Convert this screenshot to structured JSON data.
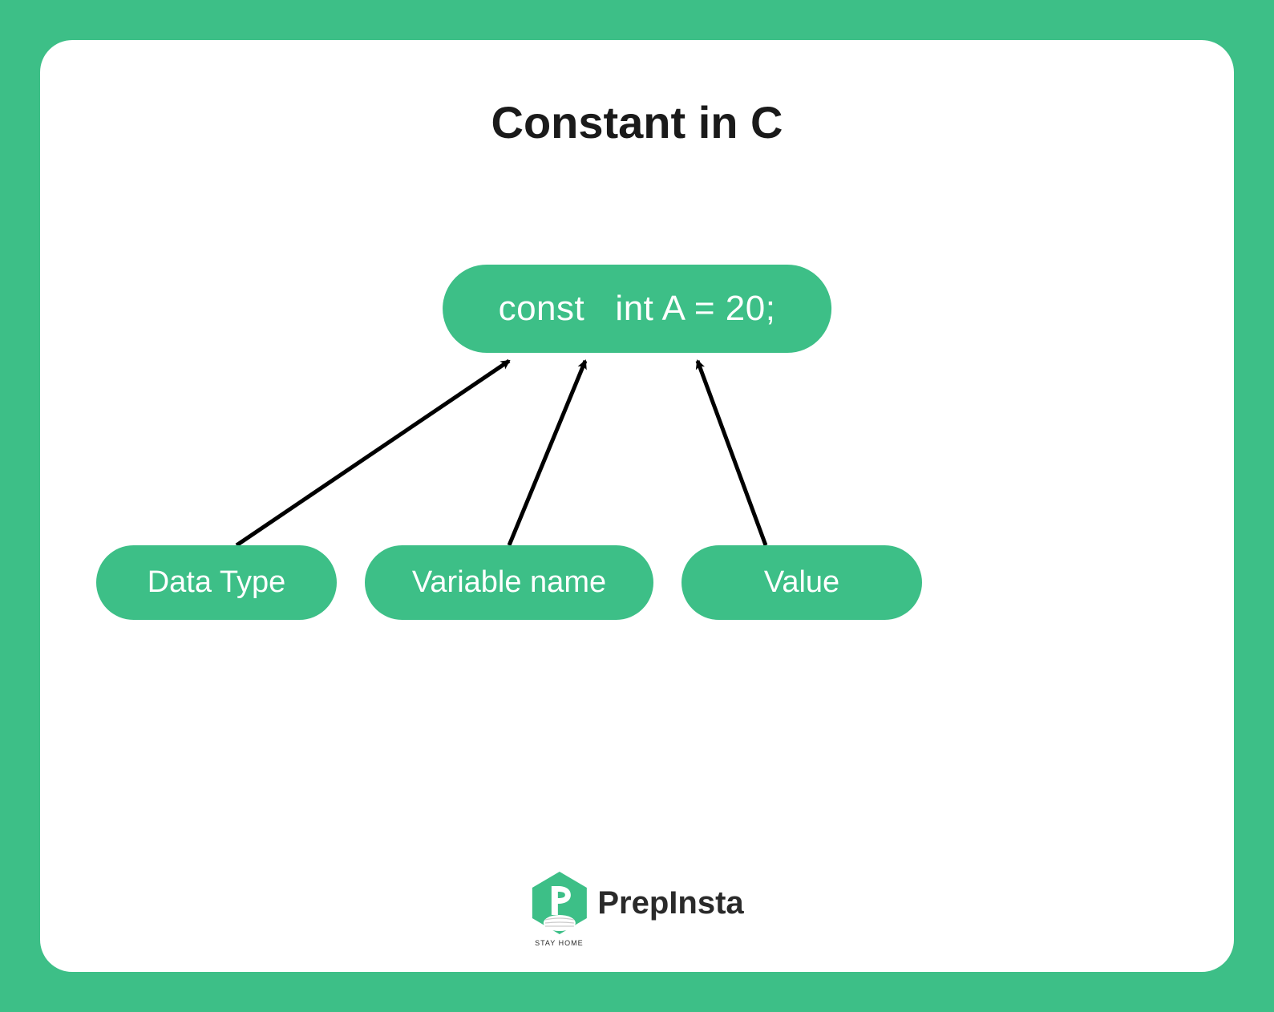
{
  "title": "Constant in C",
  "code_line": "const   int A = 20;",
  "labels": {
    "datatype": "Data Type",
    "varname": "Variable name",
    "value": "Value"
  },
  "brand": {
    "name": "PrepInsta",
    "tagline": "STAY HOME"
  },
  "colors": {
    "accent": "#3DBF87",
    "card_bg": "#ffffff",
    "text_dark": "#1a1a1a"
  }
}
